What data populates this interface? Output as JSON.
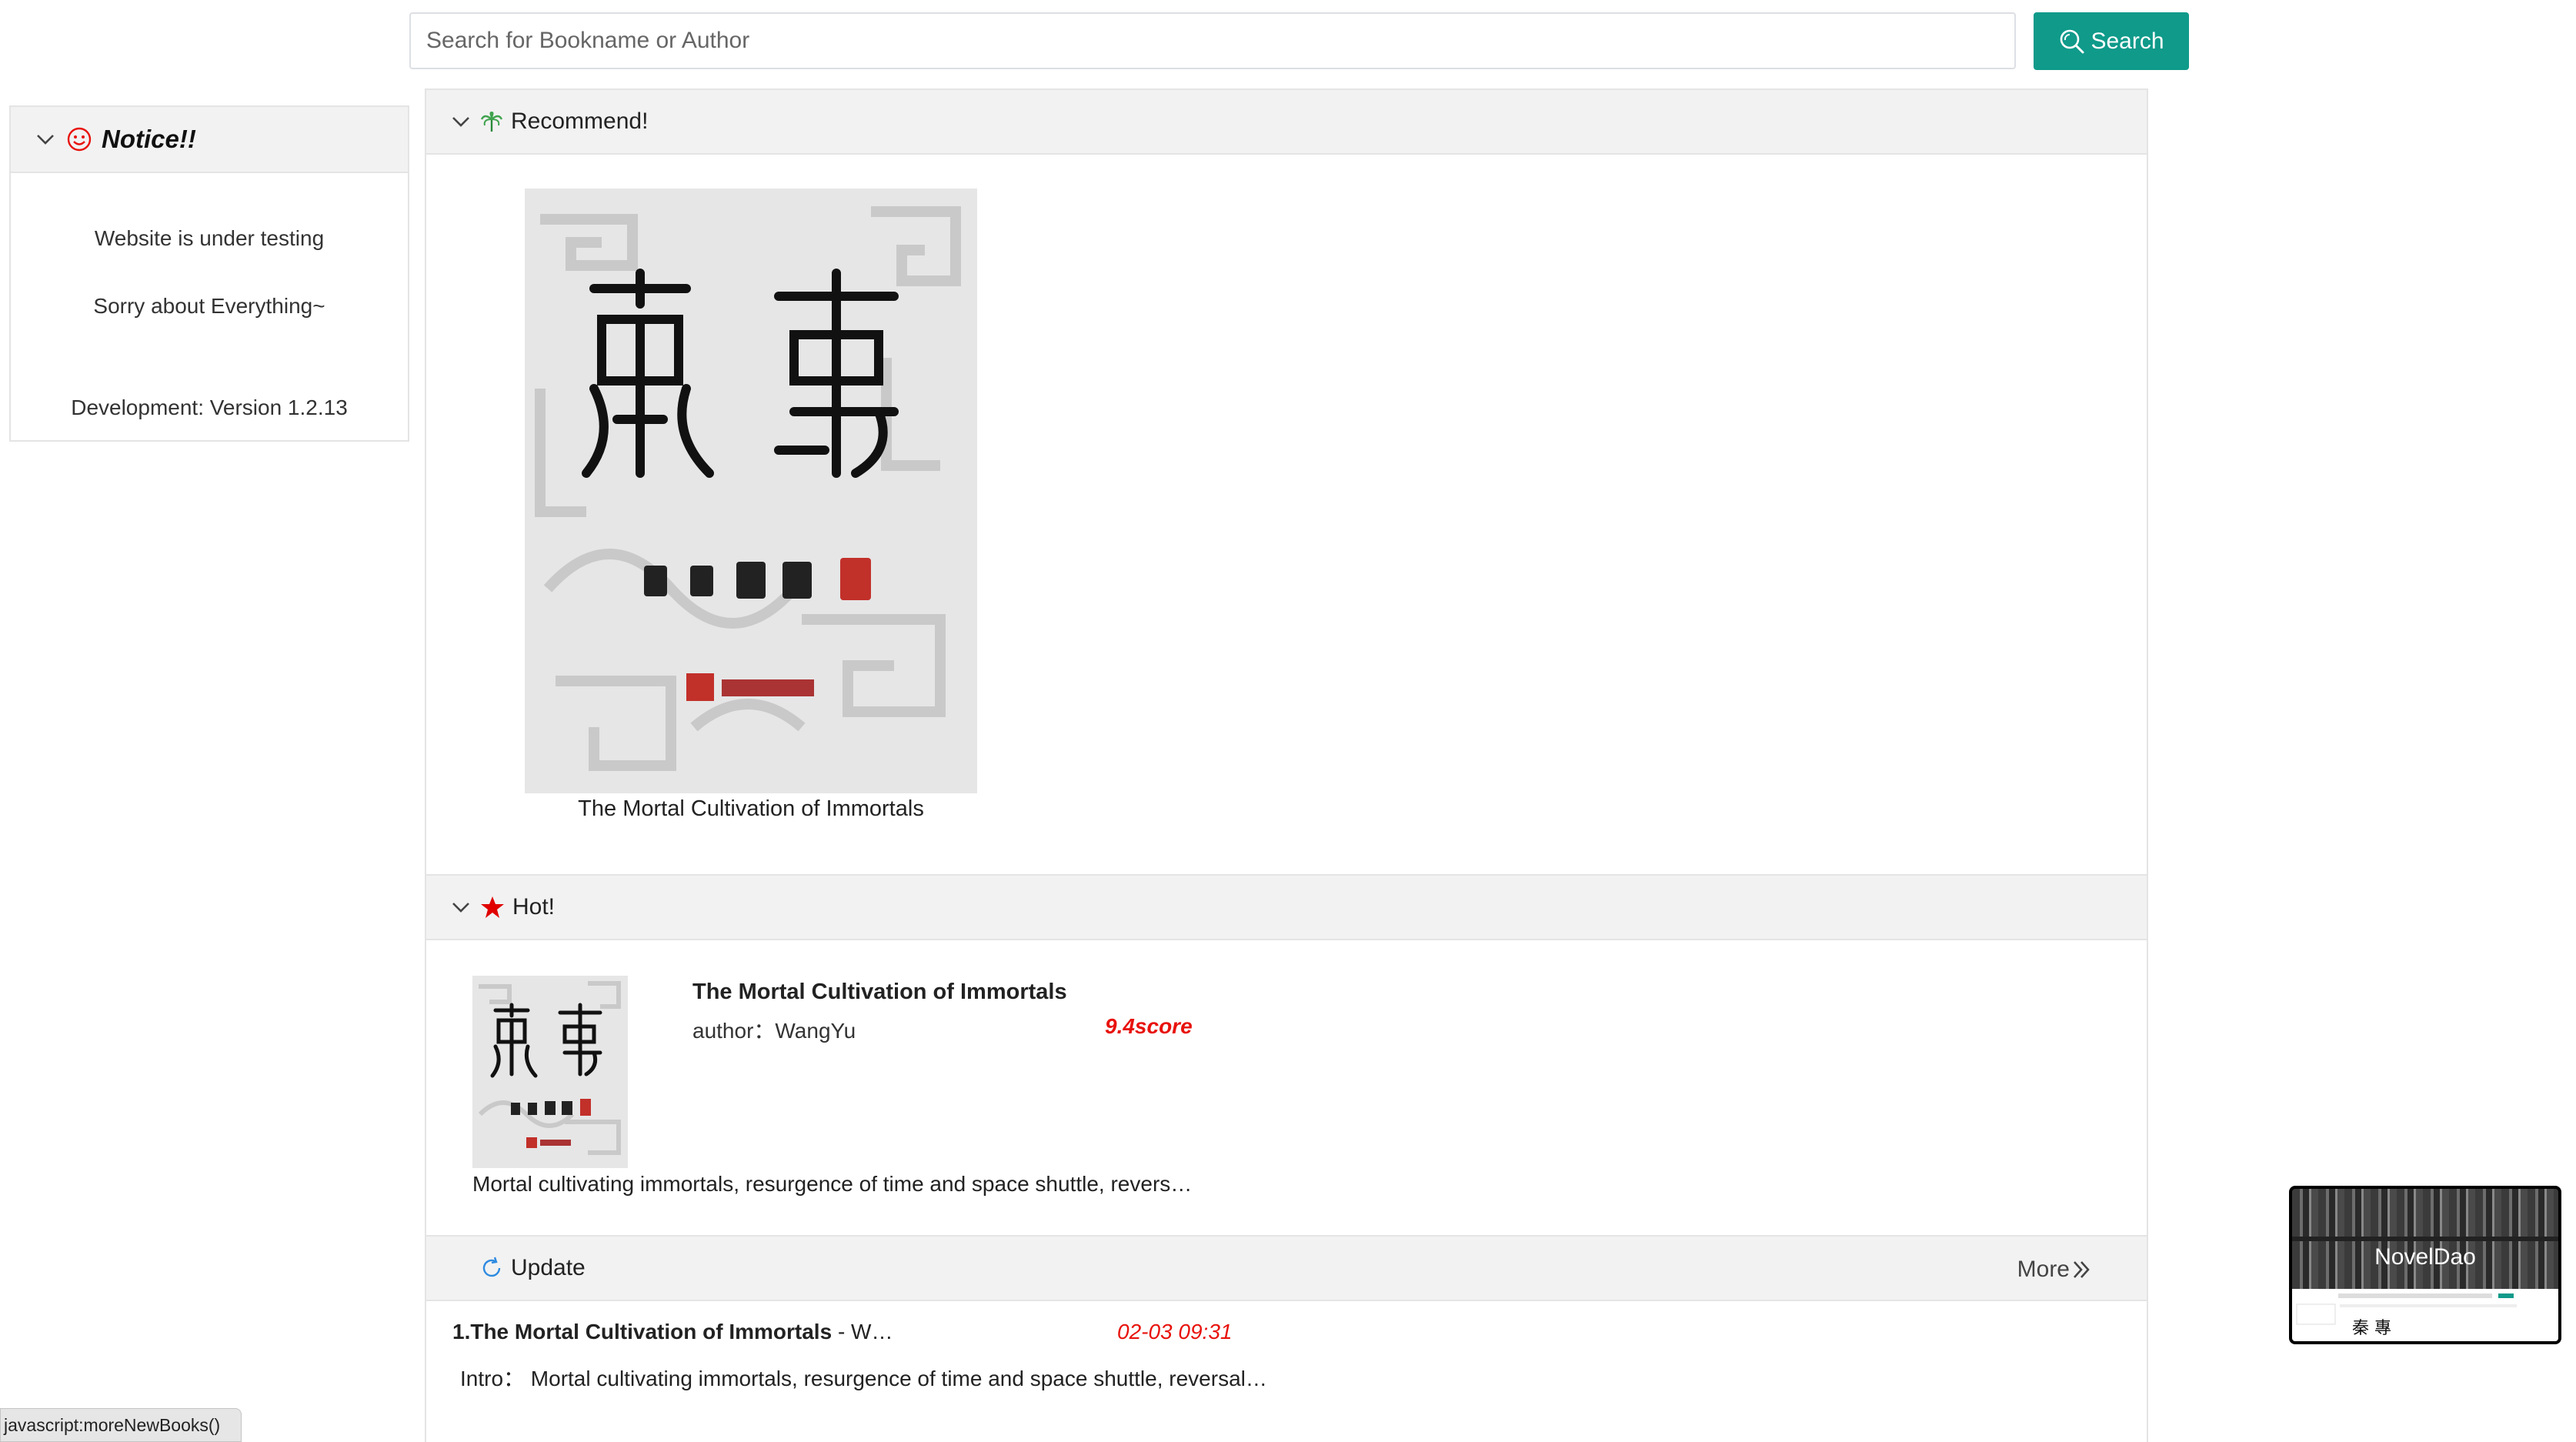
{
  "search": {
    "placeholder": "Search for Bookname or Author",
    "button_label": "Search"
  },
  "notice": {
    "title": "Notice!!",
    "lines": [
      "Website is under testing",
      "Sorry about Everything~",
      "Development: Version 1.2.13"
    ]
  },
  "recommend": {
    "title": "Recommend!",
    "book_title": "The Mortal Cultivation of Immortals"
  },
  "hot": {
    "title": "Hot!",
    "book_title": "The Mortal Cultivation of Immortals",
    "author_label": "author：",
    "author": "WangYu",
    "score": "9.4score",
    "intro": "Mortal cultivating immortals, resurgence of time and space shuttle, revers…"
  },
  "update": {
    "title": "Update",
    "more_label": "More",
    "item_title": "1.The Mortal Cultivation of Immortals",
    "item_sep": " - W…",
    "item_date": "02-03 09:31",
    "item_intro": "Intro：  Mortal cultivating immortals, resurgence of time and space shuttle, reversal…"
  },
  "statusbar": {
    "text": "javascript:moreNewBooks()"
  },
  "preview": {
    "title": "NovelDao"
  },
  "colors": {
    "accent": "#0f9a8a",
    "score": "#e8120c",
    "notice_icon": "#e8120c",
    "star": "#e00000"
  }
}
